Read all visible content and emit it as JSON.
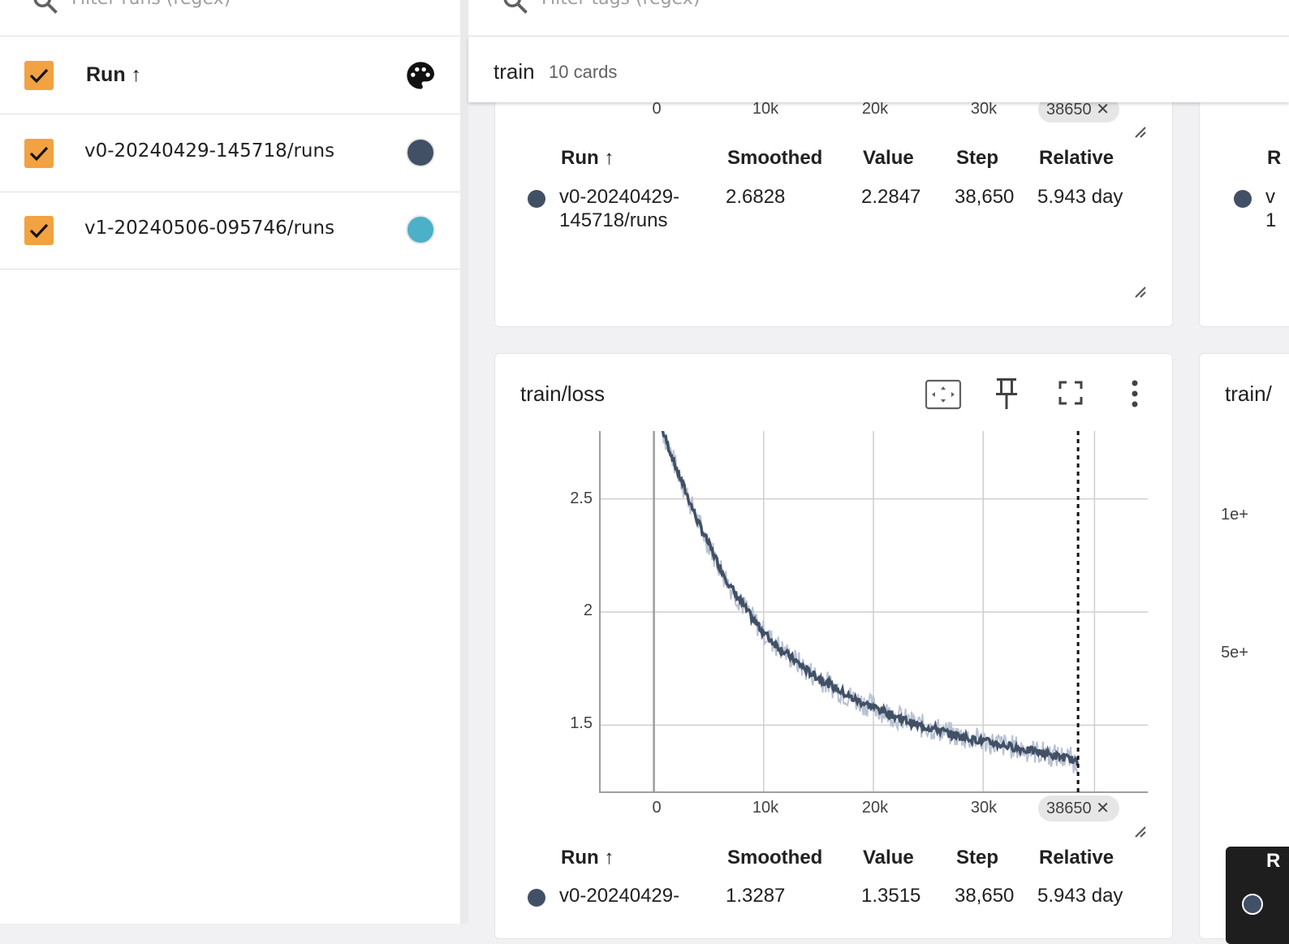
{
  "sidebar": {
    "search_placeholder": "Filter runs (regex)",
    "header_label": "Run ↑",
    "runs": [
      {
        "label": "v0-20240429-145718/runs",
        "color": "#425066"
      },
      {
        "label": "v1-20240506-095746/runs",
        "color": "#4bb0c8"
      }
    ],
    "checkbox_color": "#f2a241"
  },
  "main": {
    "tag_search_placeholder": "Filter tags (regex)",
    "group": {
      "title": "train",
      "count": "10 cards"
    },
    "top_card": {
      "x_ticks": [
        "0",
        "10k",
        "20k",
        "30k"
      ],
      "step_chip": "38650",
      "columns": [
        "Run ↑",
        "Smoothed",
        "Value",
        "Step",
        "Relative"
      ],
      "row": {
        "run_line1": "v0-20240429-",
        "run_line2": "145718/runs",
        "smoothed": "2.6828",
        "value": "2.2847",
        "step": "38,650",
        "relative": "5.943 day"
      }
    },
    "right_card_top": {
      "header_fragment": "R",
      "run_fragment_1": "v",
      "run_fragment_2": "1"
    },
    "loss_card": {
      "title": "train/loss",
      "y_ticks": [
        "2.5",
        "2",
        "1.5"
      ],
      "x_ticks": [
        "0",
        "10k",
        "20k",
        "30k"
      ],
      "step_chip": "38650",
      "columns": [
        "Run ↑",
        "Smoothed",
        "Value",
        "Step",
        "Relative"
      ],
      "row": {
        "run_line1": "v0-20240429-",
        "smoothed": "1.3287",
        "value": "1.3515",
        "step": "38,650",
        "relative": "5.943 day"
      }
    },
    "right_card_bottom": {
      "title_fragment": "train/",
      "y_ticks": [
        "1e+",
        "5e+"
      ],
      "tooltip_fragment": "R"
    }
  },
  "chart_data": {
    "type": "line",
    "title": "train/loss",
    "xlabel": "",
    "ylabel": "",
    "xlim": [
      -5000,
      45000
    ],
    "ylim": [
      1.2,
      2.8
    ],
    "x_ticks": [
      0,
      10000,
      20000,
      30000
    ],
    "y_ticks": [
      1.5,
      2,
      2.5
    ],
    "selected_step": 38650,
    "grid": true,
    "series": [
      {
        "color": "#425066",
        "raw_color": "#b8c2d3",
        "x": [
          800,
          2000,
          3000,
          4000,
          5000,
          6000,
          7000,
          8000,
          9000,
          10000,
          11000,
          12000,
          13000,
          14000,
          15000,
          16000,
          17000,
          18000,
          19000,
          20000,
          21000,
          22000,
          23000,
          24000,
          25000,
          26000,
          27000,
          28000,
          29000,
          30000,
          31000,
          32000,
          33000,
          34000,
          35000,
          36000,
          37000,
          38000,
          38650
        ],
        "smoothed": [
          2.8,
          2.64,
          2.52,
          2.4,
          2.3,
          2.2,
          2.11,
          2.04,
          1.97,
          1.91,
          1.86,
          1.82,
          1.78,
          1.74,
          1.71,
          1.68,
          1.65,
          1.62,
          1.6,
          1.58,
          1.56,
          1.54,
          1.52,
          1.5,
          1.49,
          1.48,
          1.46,
          1.45,
          1.44,
          1.43,
          1.42,
          1.41,
          1.4,
          1.39,
          1.38,
          1.37,
          1.36,
          1.35,
          1.33
        ]
      }
    ]
  }
}
